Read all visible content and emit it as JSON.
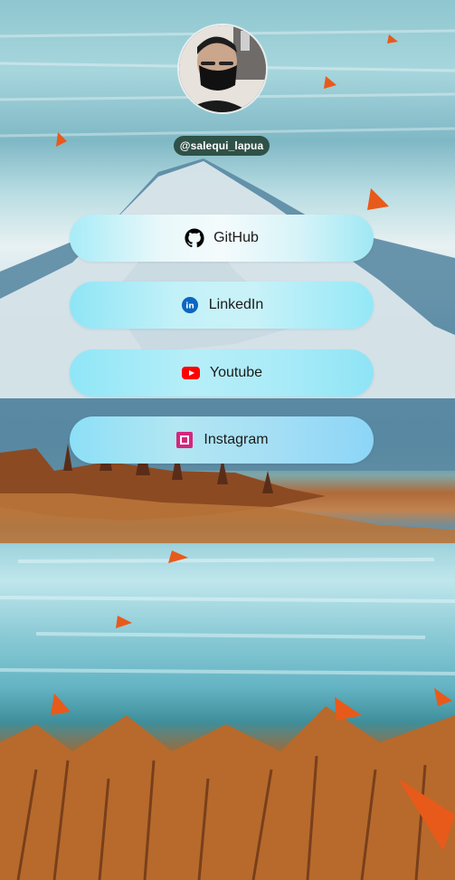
{
  "profile": {
    "username": "@salequi_lapua"
  },
  "links": [
    {
      "label": "GitHub",
      "icon": "github-icon"
    },
    {
      "label": "LinkedIn",
      "icon": "linkedin-icon"
    },
    {
      "label": "Youtube",
      "icon": "youtube-icon"
    },
    {
      "label": "Instagram",
      "icon": "instagram-icon"
    }
  ],
  "colors": {
    "username_badge": "#2f5147",
    "button_accent": "#9fe8f4",
    "linkedin_blue": "#0a66c2",
    "youtube_red": "#ff0000",
    "instagram_magenta": "#e1306c"
  }
}
